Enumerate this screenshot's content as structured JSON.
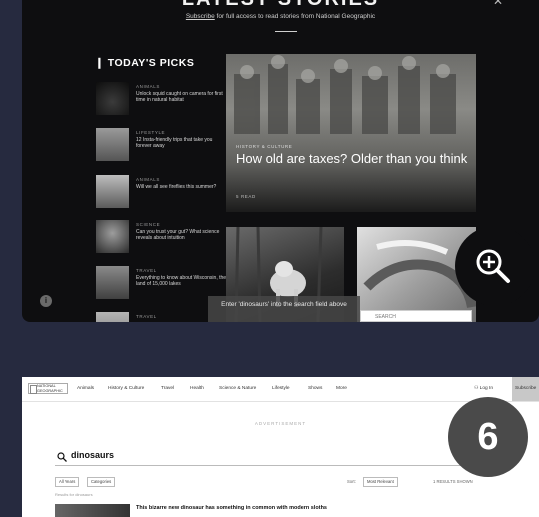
{
  "panel1": {
    "title": "LATEST STORIES",
    "subline_link": "Subscribe",
    "subline_rest": " for full access to read stories from National Geographic",
    "close_glyph": "✕",
    "picks_heading": "TODAY'S PICKS",
    "picks": [
      {
        "category": "Animals",
        "text": "Unlock squid caught on camera for first time in natural habitat"
      },
      {
        "category": "Lifestyle",
        "text": "12 Insta-friendly trips that take you forever away"
      },
      {
        "category": "Animals",
        "text": "Will we all see fireflies this summer?"
      },
      {
        "category": "Science",
        "text": "Can you trust your gut? What science reveals about intuition"
      },
      {
        "category": "Travel",
        "text": "Everything to know about Wisconsin, the land of 15,000 lakes"
      },
      {
        "category": "Travel",
        "text": ""
      }
    ],
    "hero": {
      "tag": "HISTORY & CULTURE",
      "title": "How old are taxes? Older than you think",
      "meta": "5 READ"
    },
    "tooltip": "Enter 'dinosaurs' into the search field above",
    "search_mini": "SEARCH",
    "info_glyph": "i"
  },
  "panel2": {
    "logo": "NATIONAL GEOGRAPHIC",
    "nav": [
      "Animals",
      "History & Culture",
      "Travel",
      "Health",
      "Science & Nature",
      "Lifestyle",
      "Shows",
      "More"
    ],
    "login": "Log In",
    "subscribe": "Subscribe",
    "ad_label": "ADVERTISEMENT",
    "search_query": "dinosaurs",
    "chips": [
      "All Years",
      "Categories"
    ],
    "sort_label": "Sort:",
    "sort_value": "Most Relevant",
    "results_label": "1 RESULTS SHOWN",
    "count": "Results for dinosaurs",
    "first_result": "This bizarre new dinosaur has something in common with modern sloths"
  },
  "step_number": "6",
  "colors": {
    "page_bg": "#262a3f",
    "dark_panel": "#0e0e10",
    "badge": "#4a4a4a"
  }
}
